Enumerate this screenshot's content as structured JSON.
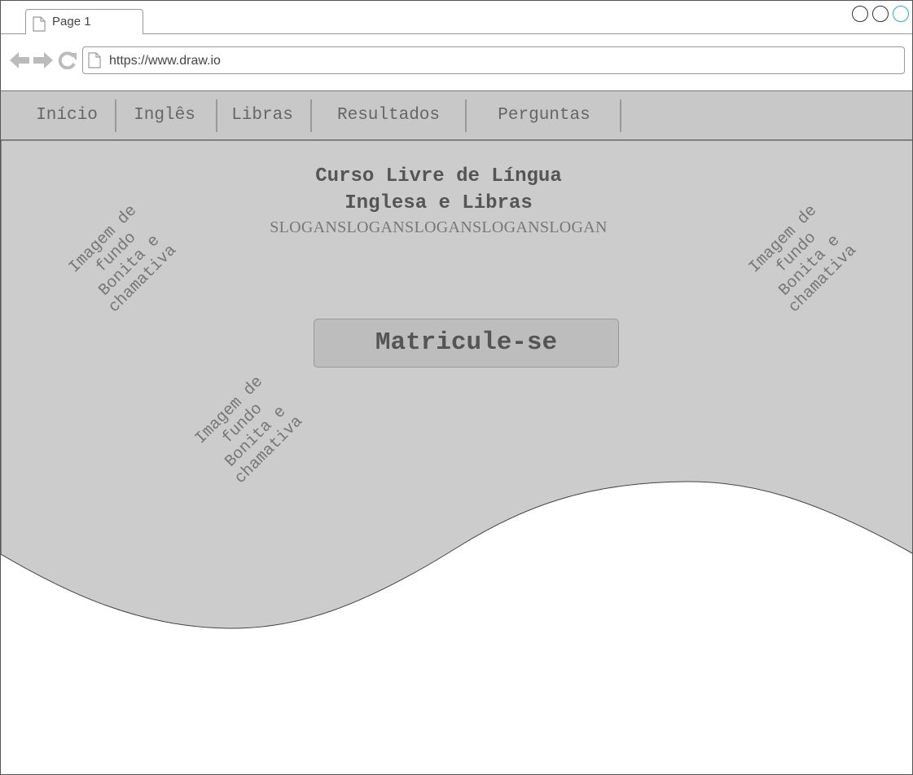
{
  "browser": {
    "tab_label": "Page 1",
    "url": "https://www.draw.io",
    "icons": [
      "page-icon",
      "back-icon",
      "forward-icon",
      "reload-icon"
    ]
  },
  "nav": {
    "items": [
      {
        "label": "Início"
      },
      {
        "label": "Inglês"
      },
      {
        "label": "Libras"
      },
      {
        "label": "Resultados"
      },
      {
        "label": "Perguntas"
      }
    ]
  },
  "hero": {
    "title_line1": "Curso Livre de Língua",
    "title_line2": "Inglesa e Libras",
    "slogan": "SLOGANSLOGANSLOGANSLOGANSLOGAN",
    "cta_label": "Matricule-se",
    "image_notes": [
      {
        "line1": "Imagem de",
        "line2": "fundo",
        "line3": "Bonita e",
        "line4": "chamativa"
      },
      {
        "line1": "Imagem de",
        "line2": "fundo",
        "line3": "Bonita e",
        "line4": "chamativa"
      },
      {
        "line1": "Imagem de",
        "line2": "fundo",
        "line3": "Bonita e",
        "line4": "chamativa"
      }
    ]
  },
  "colors": {
    "hero_background": "#cccccc",
    "nav_background": "#c8c8c8",
    "text_dark": "#555555",
    "text_muted": "#777777",
    "accent_circle": "#2aa9d6"
  }
}
